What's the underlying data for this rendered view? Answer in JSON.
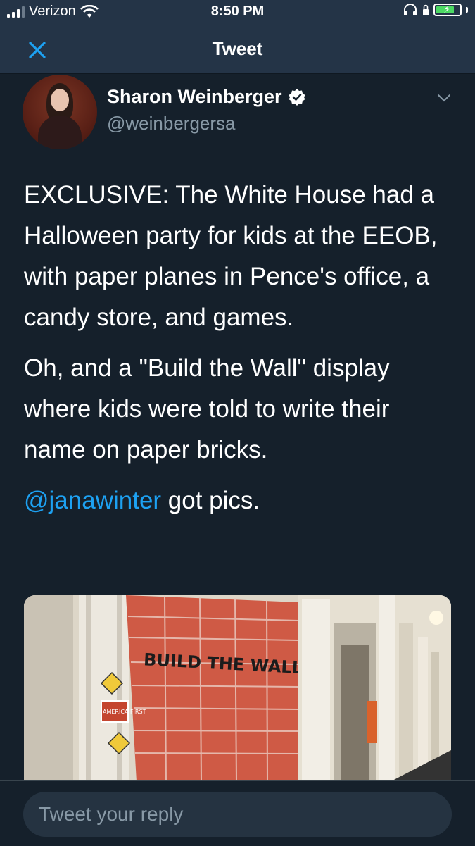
{
  "status_bar": {
    "carrier": "Verizon",
    "time": "8:50 PM",
    "battery_level": 0.7
  },
  "nav": {
    "title": "Tweet",
    "close_icon": "close-icon"
  },
  "author": {
    "name": "Sharon Weinberger",
    "handle": "@weinbergersa",
    "verified": true
  },
  "tweet": {
    "paragraph1": "EXCLUSIVE: The White House had a Halloween party for kids at the EEOB, with paper planes in Pence's office, a candy store, and games.",
    "paragraph2": "Oh, and a \"Build the Wall\" display where kids were told to write their name on paper bricks.",
    "mention": "@janawinter",
    "paragraph3_rest": " got pics."
  },
  "photo": {
    "sign_text": "BUILD THE WALL",
    "poster_text": "AMERICA FIRST"
  },
  "reply": {
    "placeholder": "Tweet your reply"
  },
  "colors": {
    "background": "#15202b",
    "header": "#243447",
    "accent": "#1da1f2",
    "secondary_text": "#8899a6"
  }
}
